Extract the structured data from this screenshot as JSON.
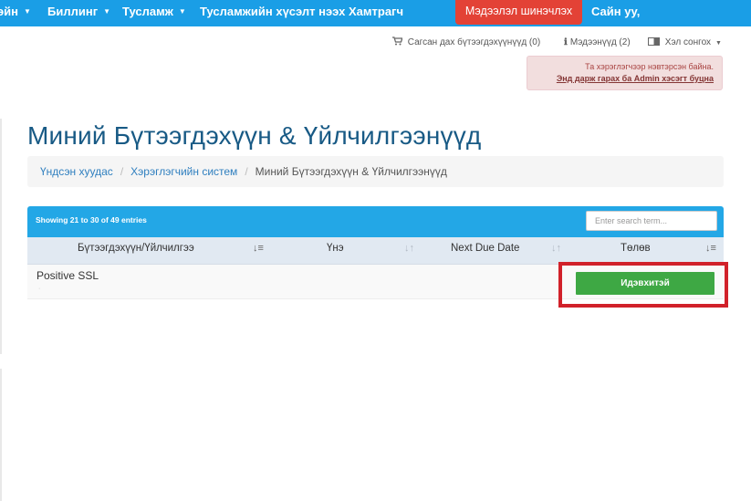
{
  "nav": {
    "items": [
      {
        "label": "эйн",
        "caret": true
      },
      {
        "label": "Биллинг",
        "caret": true
      },
      {
        "label": "Тусламж",
        "caret": true
      },
      {
        "label": "Тусламжийн хүсэлт нээх",
        "caret": false
      },
      {
        "label": "Хамтрагч",
        "caret": false
      }
    ],
    "update_button": "Мэдээлэл шинэчлэх",
    "greeting": "Сайн уу,"
  },
  "util": {
    "cart": "Сагсан дах бүтээгдэхүүнүүд (0)",
    "notices": "Мэдээнүүд (2)",
    "language": "Хэл сонгох"
  },
  "alert": {
    "text": "Та хэрэглэгчээр нэвтэрсэн байна.",
    "link": "Энд дарж гарах ба Admin хэсэгт буцна"
  },
  "page": {
    "title": "Миний Бүтээгдэхүүн & Үйлчилгээнүүд"
  },
  "breadcrumb": {
    "home": "Үндсэн хуудас",
    "system": "Хэрэглэгчийн систем",
    "current": "Миний Бүтээгдэхүүн & Үйлчилгээнүүд"
  },
  "table": {
    "info": "Showing 21 to 30 of 49 entries",
    "search_placeholder": "Enter search term...",
    "columns": {
      "product": "Бүтээгдэхүүн/Үйлчилгээ",
      "price": "Үнэ",
      "due": "Next Due Date",
      "status": "Төлөв"
    },
    "rows": [
      {
        "product": "Positive SSL",
        "status": "Идэвхитэй"
      }
    ]
  },
  "colors": {
    "nav": "#1a9ee6",
    "update_button": "#e34236",
    "title": "#185a85",
    "status_active": "#3ea844",
    "highlight": "#d1212a"
  },
  "icons": {
    "cart": "cart-icon",
    "notices": "info-icon",
    "language": "language-icon",
    "sort": "sort-icon"
  }
}
